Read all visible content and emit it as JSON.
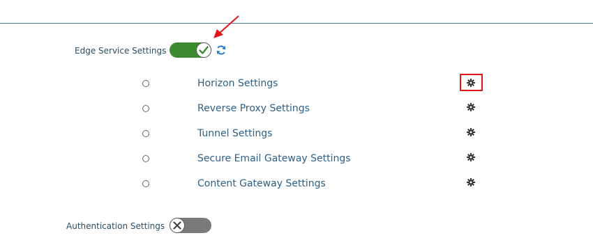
{
  "edge_service": {
    "label": "Edge Service Settings",
    "toggle_state": "on",
    "toggle_icon": "check-icon",
    "refresh_icon": "refresh-icon"
  },
  "services": [
    {
      "label": "Horizon Settings",
      "icon": "gear-icon",
      "highlighted": true
    },
    {
      "label": "Reverse Proxy Settings",
      "icon": "gear-icon"
    },
    {
      "label": "Tunnel Settings",
      "icon": "gear-icon"
    },
    {
      "label": "Secure Email Gateway Settings",
      "icon": "gear-icon"
    },
    {
      "label": "Content Gateway Settings",
      "icon": "gear-icon"
    }
  ],
  "authentication": {
    "label": "Authentication Settings",
    "toggle_state": "off",
    "toggle_icon": "x-icon"
  },
  "colors": {
    "toggle_on": "#3a8a2e",
    "toggle_off": "#7a7a7a",
    "link_text": "#2f5f86",
    "annotation_red": "#e5141b",
    "refresh_blue": "#2b7cc6"
  }
}
